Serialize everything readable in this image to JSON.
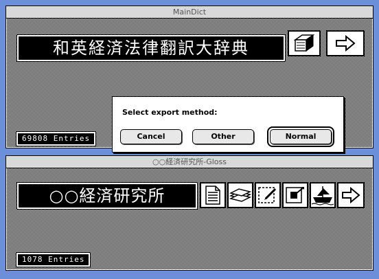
{
  "dict_window": {
    "title": "MainDict",
    "dictionary_name": "和英経済法律翻訳大辞典",
    "entry_count": "69808 Entries",
    "icons": [
      "stack-icon",
      "next-arrow-icon"
    ]
  },
  "gloss_window": {
    "title": "○○経済研究所-Gloss",
    "dictionary_name": "○○経済研究所",
    "entry_count": "1078 Entries",
    "icons": [
      "document-list-icon",
      "card-stack-icon",
      "edit-card-icon",
      "export-card-icon",
      "ship-icon",
      "next-arrow-icon"
    ]
  },
  "dialog": {
    "message": "Select export method:",
    "buttons": {
      "cancel": "Cancel",
      "other": "Other",
      "normal": "Normal"
    },
    "default_button": "normal"
  },
  "colors": {
    "desktop": "#6b8fd8",
    "title_box": "#000000",
    "titlebar": "#d9d9d9"
  }
}
